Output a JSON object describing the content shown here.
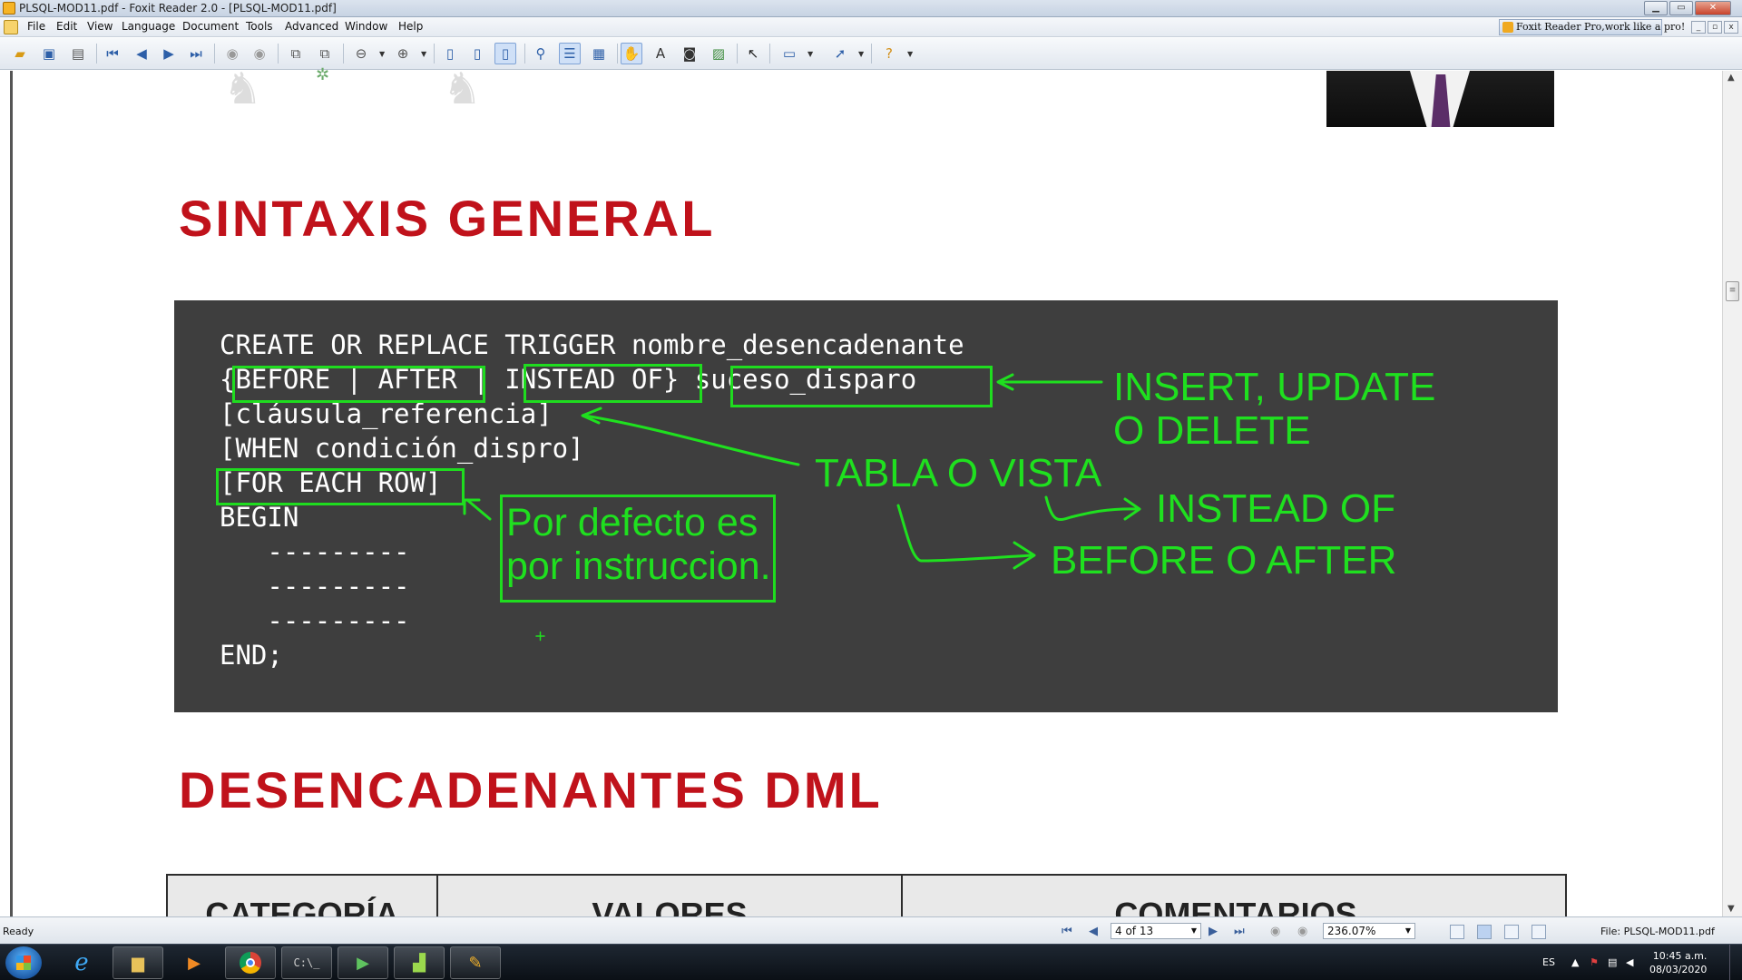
{
  "window": {
    "title": "PLSQL-MOD11.pdf - Foxit Reader 2.0 - [PLSQL-MOD11.pdf]",
    "buttons": [
      "minimize",
      "maximize",
      "close"
    ]
  },
  "menu": {
    "items": [
      "File",
      "Edit",
      "View",
      "Language",
      "Document",
      "Tools",
      "Advanced",
      "Window",
      "Help"
    ],
    "promo": "Foxit Reader Pro,work like a pro!"
  },
  "toolbar": {
    "icons": [
      "open-icon",
      "save-icon",
      "print-icon",
      "first-page-icon",
      "prev-page-icon",
      "next-page-icon",
      "last-page-icon",
      "back-icon",
      "forward-icon",
      "extract-icon",
      "copy-icon",
      "zoom-out-icon",
      "zoom-in-icon",
      "actual-size-icon",
      "fit-page-icon",
      "fit-width-icon",
      "find-icon",
      "bookmarks-icon",
      "thumbnails-icon",
      "hand-icon",
      "text-select-icon",
      "snapshot-icon",
      "image-icon",
      "select-icon",
      "typewriter-icon",
      "note-icon",
      "help-icon"
    ]
  },
  "document": {
    "heading1": "SINTAXIS GENERAL",
    "heading2": "DESENCADENANTES DML",
    "code_lines": [
      "CREATE OR REPLACE TRIGGER nombre_desencadenante",
      "{BEFORE | AFTER | INSTEAD OF} suceso_disparo",
      "[cláusula_referencia]",
      "[WHEN condición_dispro]",
      "[FOR EACH ROW]",
      "BEGIN",
      "   ---------",
      "   ---------",
      "   ---------",
      "END;"
    ],
    "annotations": {
      "insert_update": "INSERT, UPDATE",
      "o_delete": "O DELETE",
      "tabla_o_vista": "TABLA O VISTA",
      "instead_of": "INSTEAD OF",
      "before_o_after": "BEFORE O AFTER",
      "por_defecto_1": "Por defecto es",
      "por_defecto_2": "por instruccion."
    },
    "table_headers": [
      "CATEGORÍA",
      "VALORES",
      "COMENTARIOS"
    ]
  },
  "statusbar": {
    "ready": "Ready",
    "page": "4 of 13",
    "zoom": "236.07%",
    "file": "File: PLSQL-MOD11.pdf"
  },
  "taskbar": {
    "apps": [
      "start-button",
      "internet-explorer",
      "file-explorer",
      "media-player",
      "chrome",
      "command-prompt",
      "video-app",
      "notepad-chart-app",
      "foxit-reader"
    ],
    "language": "ES",
    "time": "10:45 a.m.",
    "date": "08/03/2020"
  },
  "colors": {
    "heading_red": "#c0121b",
    "annotation_green": "#1fe01f",
    "code_background": "#3e3e3e"
  }
}
